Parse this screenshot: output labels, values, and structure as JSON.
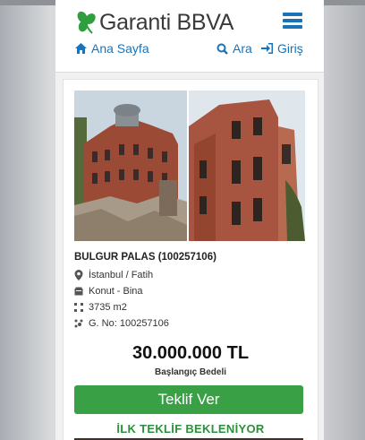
{
  "header": {
    "brand_name": "Garanti BBVA",
    "nav": {
      "home_label": "Ana Sayfa",
      "search_label": "Ara",
      "login_label": "Giriş"
    }
  },
  "listing": {
    "title": "BULGUR PALAS (100257106)",
    "location": "İstanbul / Fatih",
    "type": "Konut - Bina",
    "area": "3735 m2",
    "listing_no": "G. No: 100257106",
    "price": "30.000.000 TL",
    "price_label": "Başlangıç Bedeli",
    "offer_button_label": "Teklif Ver",
    "status_text": "İLK TEKLİF BEKLENİYOR"
  },
  "colors": {
    "brand_blue": "#1a73b8",
    "brand_green": "#3aa046",
    "status_green": "#2e8f3c"
  },
  "icons": [
    "garanti-clover-logo",
    "hamburger-menu-icon",
    "home-icon",
    "search-icon",
    "sign-in-icon",
    "location-pin-icon",
    "building-icon",
    "area-icon",
    "listing-number-icon"
  ]
}
